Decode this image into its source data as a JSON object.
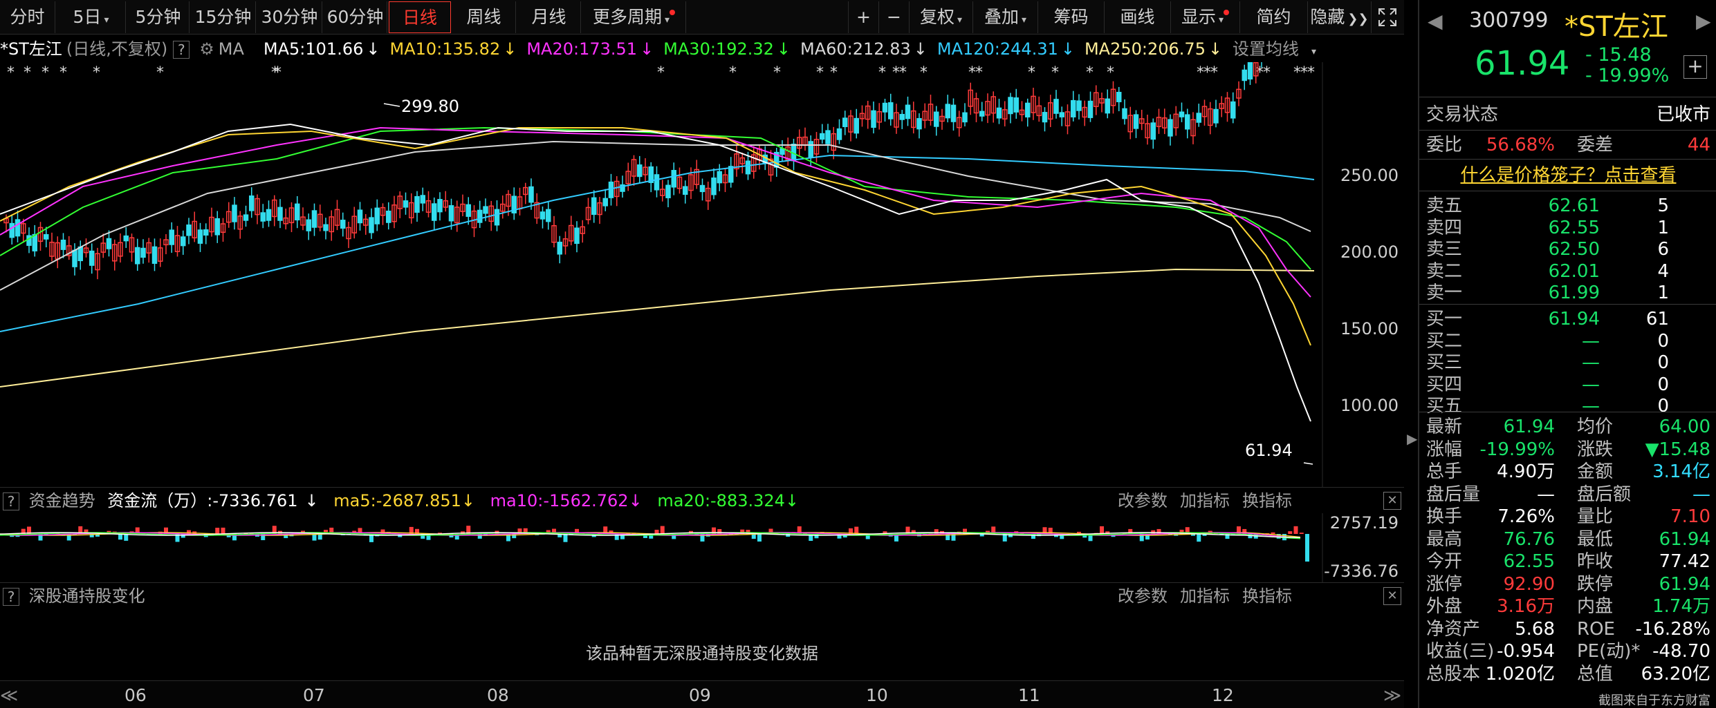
{
  "toolbar": {
    "tabs": [
      "分时",
      "5日",
      "5分钟",
      "15分钟",
      "30分钟",
      "60分钟",
      "日线",
      "周线",
      "月线",
      "更多周期"
    ],
    "active_tab": "日线",
    "right": {
      "plus": "+",
      "minus": "−",
      "fuquan": "复权",
      "overlay": "叠加",
      "chips": "筹码",
      "draw": "画线",
      "display": "显示",
      "simple": "简约",
      "hide": "隐藏"
    }
  },
  "ma_bar": {
    "stock": "*ST左江",
    "mode": "(日线,不复权)",
    "help": "?",
    "ma_label": "MA",
    "items": [
      {
        "text": "MA5:101.66",
        "arrow": "↓",
        "color": "#ffffff"
      },
      {
        "text": "MA10:135.82",
        "arrow": "↓",
        "color": "#ffd633"
      },
      {
        "text": "MA20:173.51",
        "arrow": "↓",
        "color": "#ff33ff"
      },
      {
        "text": "MA30:192.32",
        "arrow": "↓",
        "color": "#33ff33"
      },
      {
        "text": "MA60:212.83",
        "arrow": "↓",
        "color": "#d8d8d8"
      },
      {
        "text": "MA120:244.31",
        "arrow": "↓",
        "color": "#33ccff"
      },
      {
        "text": "MA250:206.75",
        "arrow": "↓",
        "color": "#ffee99"
      }
    ],
    "settings": "设置均线"
  },
  "price_axis": [
    "250.00",
    "200.00",
    "150.00",
    "100.00"
  ],
  "annotations": {
    "high": "299.80",
    "last": "61.94"
  },
  "flow_panel": {
    "title": "资金趋势",
    "label": "资金流（万）:-7336.761",
    "ma5": "ma5:-2687.851",
    "ma10": "ma10:-1562.762",
    "ma20": "ma20:-883.324",
    "btn_params": "改参数",
    "btn_add": "加指标",
    "btn_switch": "换指标",
    "axis_top": "2757.19",
    "axis_bottom": "-7336.76"
  },
  "hk_panel": {
    "title": "深股通持股变化",
    "empty": "该品种暂无深股通持股变化数据",
    "btn_params": "改参数",
    "btn_add": "加指标",
    "btn_switch": "换指标"
  },
  "x_axis": [
    "06",
    "07",
    "08",
    "09",
    "10",
    "11",
    "12"
  ],
  "quote": {
    "code": "300799",
    "name": "*ST左江",
    "price": "61.94",
    "change": "- 15.48",
    "pct": "- 19.99%",
    "status_label": "交易状态",
    "status": "已收市",
    "weibi_label": "委比",
    "weibi": "56.68%",
    "weicha_label": "委差",
    "weicha": "44",
    "cage_link": "什么是价格笼子？点击查看",
    "asks": [
      {
        "label": "卖五",
        "price": "62.61",
        "vol": "5"
      },
      {
        "label": "卖四",
        "price": "62.55",
        "vol": "1"
      },
      {
        "label": "卖三",
        "price": "62.50",
        "vol": "6"
      },
      {
        "label": "卖二",
        "price": "62.01",
        "vol": "4"
      },
      {
        "label": "卖一",
        "price": "61.99",
        "vol": "1"
      }
    ],
    "bids": [
      {
        "label": "买一",
        "price": "61.94",
        "vol": "61"
      },
      {
        "label": "买二",
        "price": "—",
        "vol": "0"
      },
      {
        "label": "买三",
        "price": "—",
        "vol": "0"
      },
      {
        "label": "买四",
        "price": "—",
        "vol": "0"
      },
      {
        "label": "买五",
        "price": "—",
        "vol": "0"
      }
    ],
    "stats": [
      {
        "l1": "最新",
        "v1": "61.94",
        "c1": "green",
        "l2": "均价",
        "v2": "64.00",
        "c2": "green"
      },
      {
        "l1": "涨幅",
        "v1": "-19.99%",
        "c1": "green",
        "l2": "涨跌",
        "v2": "▼15.48",
        "c2": "green"
      },
      {
        "l1": "总手",
        "v1": "4.90万",
        "c1": "white",
        "l2": "金额",
        "v2": "3.14亿",
        "c2": "cyan"
      },
      {
        "l1": "盘后量",
        "v1": "—",
        "c1": "white",
        "l2": "盘后额",
        "v2": "—",
        "c2": "cyan"
      },
      {
        "l1": "换手",
        "v1": "7.26%",
        "c1": "white",
        "l2": "量比",
        "v2": "7.10",
        "c2": "red"
      },
      {
        "l1": "最高",
        "v1": "76.76",
        "c1": "green",
        "l2": "最低",
        "v2": "61.94",
        "c2": "green"
      },
      {
        "l1": "今开",
        "v1": "62.55",
        "c1": "green",
        "l2": "昨收",
        "v2": "77.42",
        "c2": "white"
      },
      {
        "l1": "涨停",
        "v1": "92.90",
        "c1": "red",
        "l2": "跌停",
        "v2": "61.94",
        "c2": "green"
      },
      {
        "l1": "外盘",
        "v1": "3.16万",
        "c1": "red",
        "l2": "内盘",
        "v2": "1.74万",
        "c2": "green"
      },
      {
        "l1": "净资产",
        "v1": "5.68",
        "c1": "white",
        "l2": "ROE",
        "v2": "-16.28%",
        "c2": "white"
      },
      {
        "l1": "收益(三)",
        "v1": "-0.954",
        "c1": "white",
        "l2": "PE(动)*",
        "v2": "-48.70",
        "c2": "white"
      },
      {
        "l1": "总股本",
        "v1": "1.020亿",
        "c1": "white",
        "l2": "总值",
        "v2": "63.20亿",
        "c2": "white"
      }
    ],
    "watermark": "截图来自于东方财富"
  }
}
